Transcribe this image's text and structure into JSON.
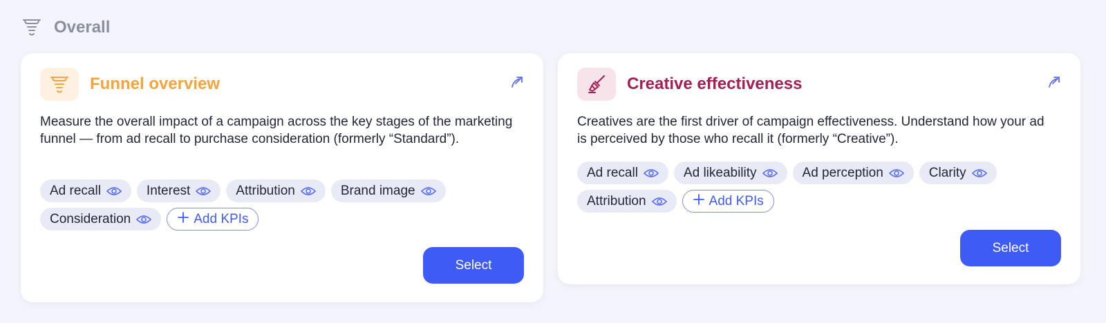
{
  "section": {
    "title": "Overall",
    "icon": "funnel-icon"
  },
  "cards": [
    {
      "title": "Funnel overview",
      "title_color": "#f6a33a",
      "icon": "funnel-icon",
      "icon_bg": "#fff1e2",
      "description": "Measure the overall impact of a campaign across the key stages of the marketing funnel — from ad recall to purchase consideration (formerly “Standard”).",
      "kpis": [
        "Ad recall",
        "Interest",
        "Attribution",
        "Brand image",
        "Consideration"
      ],
      "add_label": "Add KPIs",
      "select_label": "Select"
    },
    {
      "title": "Creative effectiveness",
      "title_color": "#a51f55",
      "icon": "paintbrush-icon",
      "icon_bg": "#f7e3ea",
      "description": "Creatives are the first driver of campaign effectiveness. Understand how your ad is perceived by those who recall it (formerly “Creative”).",
      "kpis": [
        "Ad recall",
        "Ad likeability",
        "Ad perception",
        "Clarity",
        "Attribution"
      ],
      "add_label": "Add KPIs",
      "select_label": "Select"
    }
  ],
  "colors": {
    "accent": "#3f5bf6",
    "chip_bg": "#e8eaf6",
    "background": "#f4f5fc"
  }
}
